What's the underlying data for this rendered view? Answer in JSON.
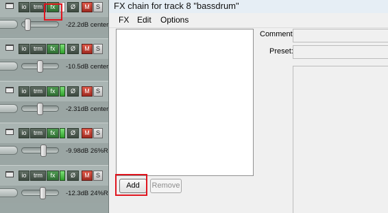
{
  "tracks": [
    {
      "io_label": "io",
      "trm_label": "trm",
      "fx_label": "fx",
      "phase_label": "Ø",
      "mute_label": "M",
      "solo_label": "S",
      "volume": "-22.2dB",
      "pan": "center",
      "fx_active": false
    },
    {
      "io_label": "io",
      "trm_label": "trm",
      "fx_label": "fx",
      "phase_label": "Ø",
      "mute_label": "M",
      "solo_label": "S",
      "volume": "-10.5dB",
      "pan": "center",
      "fx_active": true
    },
    {
      "io_label": "io",
      "trm_label": "trm",
      "fx_label": "fx",
      "phase_label": "Ø",
      "mute_label": "M",
      "solo_label": "S",
      "volume": "-2.31dB",
      "pan": "center",
      "fx_active": true
    },
    {
      "io_label": "io",
      "trm_label": "trm",
      "fx_label": "fx",
      "phase_label": "Ø",
      "mute_label": "M",
      "solo_label": "S",
      "volume": "-9.98dB",
      "pan": "26%R",
      "fx_active": true
    },
    {
      "io_label": "io",
      "trm_label": "trm",
      "fx_label": "fx",
      "phase_label": "Ø",
      "mute_label": "M",
      "solo_label": "S",
      "volume": "-12.3dB",
      "pan": "24%R",
      "fx_active": true
    }
  ],
  "window": {
    "title": "FX chain for track 8 \"bassdrum\"",
    "menu": [
      "FX",
      "Edit",
      "Options"
    ],
    "add_label": "Add",
    "remove_label": "Remove",
    "comment_label": "Comment:",
    "preset_label": "Preset:"
  },
  "colors": {
    "highlight": "#e0141e",
    "fx_active": "#2f6d33",
    "mute": "#a02a20"
  }
}
